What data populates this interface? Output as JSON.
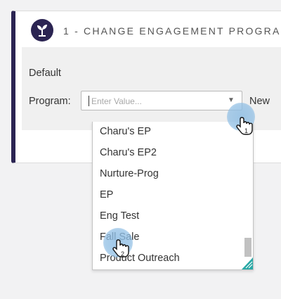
{
  "step": {
    "title": "1 - CHANGE ENGAGEMENT PROGRA",
    "icon": "sprout-icon"
  },
  "form": {
    "default_label": "Default",
    "program_label": "Program:",
    "program_placeholder": "Enter Value...",
    "new_text": "New"
  },
  "dropdown": {
    "items": [
      "Charu's EP",
      "Charu's EP2",
      "Nurture-Prog",
      "EP",
      "Eng Test",
      "Fall Sale",
      "Product Outreach"
    ]
  },
  "annotations": {
    "step1": "1",
    "step2": "2"
  },
  "colors": {
    "accent": "#2b2452",
    "highlight": "#8fbee4",
    "background": "#f2f2f3"
  }
}
